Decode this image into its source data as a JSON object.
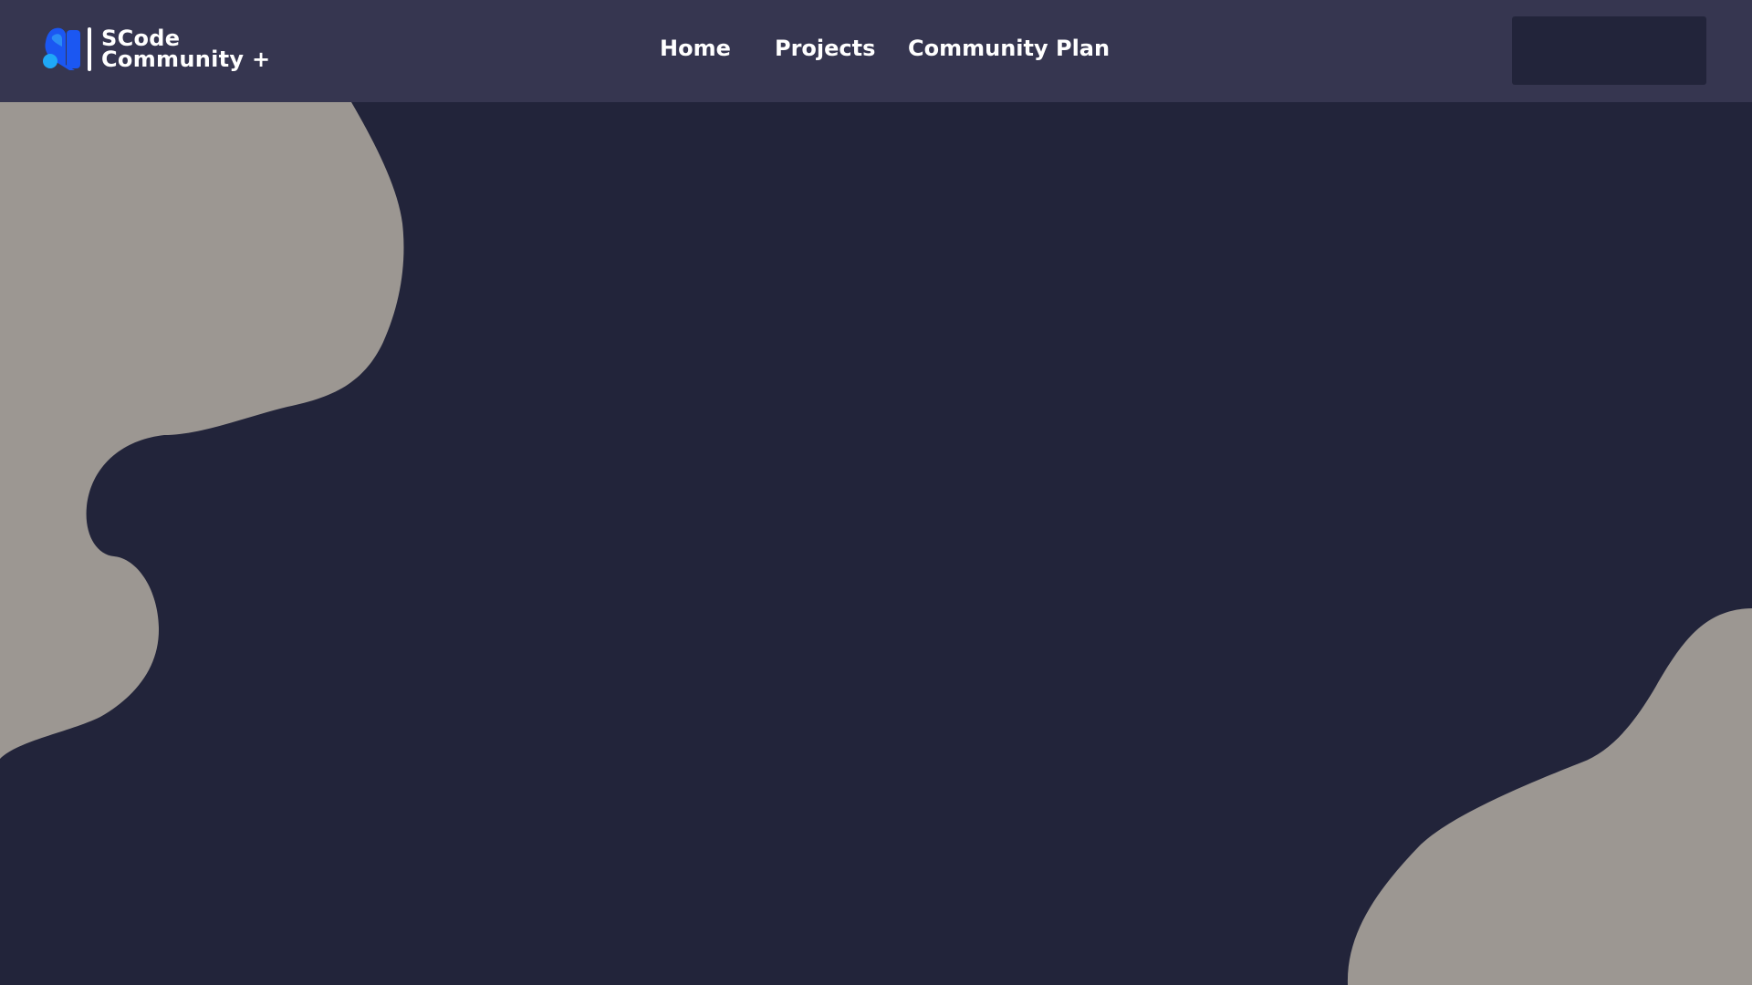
{
  "brand": {
    "line1": "SCode",
    "line2": "Community +",
    "logo_icon": "scode-logo-icon",
    "logo_colors": [
      "#1fa8f7",
      "#1b57f2",
      "#2a8cf5"
    ]
  },
  "nav": {
    "items": [
      {
        "label": "Home"
      },
      {
        "label": "Projects"
      },
      {
        "label": "Community Plan"
      }
    ],
    "action_label": ""
  },
  "colors": {
    "background": "#22243a",
    "navbar": "#363650",
    "blob": "#9c9792",
    "text": "#ffffff"
  }
}
